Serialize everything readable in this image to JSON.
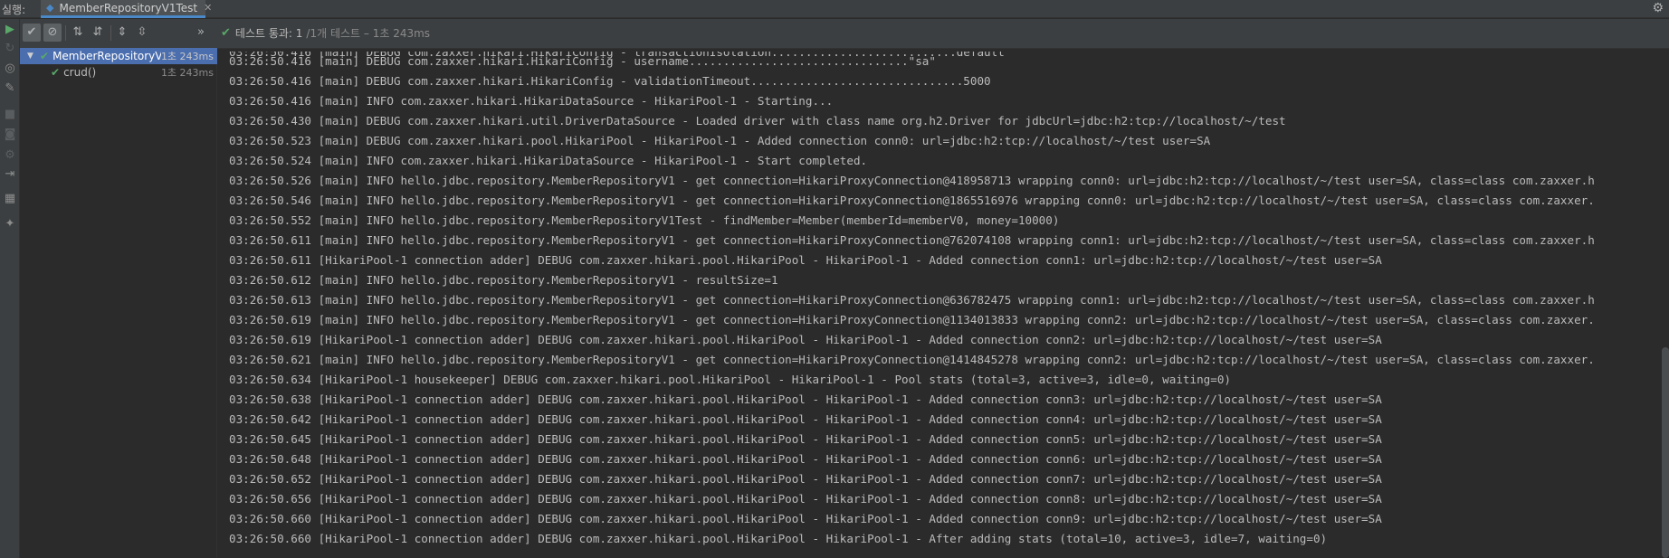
{
  "topbar": {
    "run_label": "실행:",
    "tab_title": "MemberRepositoryV1Test",
    "tab_icon": "run-config-icon",
    "close_icon": "close-icon",
    "settings_icon": "gear-icon"
  },
  "left_toolbar": [
    {
      "name": "rerun-icon",
      "glyph": "▶"
    },
    {
      "name": "rerun-failed-icon",
      "glyph": "↻"
    },
    {
      "name": "debug-icon",
      "glyph": "◎"
    },
    {
      "name": "wrench-icon",
      "glyph": "🔧"
    },
    {
      "name": "stop-icon",
      "glyph": "■"
    },
    {
      "name": "camera-icon",
      "glyph": "◙"
    },
    {
      "name": "settings-icon",
      "glyph": "⚙"
    },
    {
      "name": "exit-icon",
      "glyph": "⇥"
    },
    {
      "name": "layout-icon",
      "glyph": "▦"
    },
    {
      "name": "pin-icon",
      "glyph": "📌"
    }
  ],
  "test_toolbar": {
    "buttons": [
      {
        "name": "show-passed-button",
        "glyph": "✔"
      },
      {
        "name": "show-ignored-button",
        "glyph": "⊘"
      },
      {
        "name": "sort-alpha-button",
        "glyph": "⇅"
      },
      {
        "name": "sort-duration-button",
        "glyph": "⇵"
      },
      {
        "name": "expand-all-button",
        "glyph": "⇕"
      },
      {
        "name": "collapse-all-button",
        "glyph": "⇳"
      },
      {
        "name": "more-button",
        "glyph": "»"
      }
    ],
    "status_text": "테스트 통과: 1",
    "status_detail": "/1개 테스트 – 1초 243ms"
  },
  "tree": {
    "root": {
      "label": "MemberRepositoryV1",
      "time": "1초 243ms"
    },
    "children": [
      {
        "label": "crud()",
        "time": "1초 243ms"
      }
    ]
  },
  "console": {
    "lines": [
      "03:26:50.416 [main] DEBUG com.zaxxer.hikari.HikariConfig - username................................\"sa\"",
      "03:26:50.416 [main] DEBUG com.zaxxer.hikari.HikariConfig - validationTimeout...............................5000",
      "03:26:50.416 [main] INFO com.zaxxer.hikari.HikariDataSource - HikariPool-1 - Starting...",
      "03:26:50.430 [main] DEBUG com.zaxxer.hikari.util.DriverDataSource - Loaded driver with class name org.h2.Driver for jdbcUrl=jdbc:h2:tcp://localhost/~/test",
      "03:26:50.523 [main] DEBUG com.zaxxer.hikari.pool.HikariPool - HikariPool-1 - Added connection conn0: url=jdbc:h2:tcp://localhost/~/test user=SA",
      "03:26:50.524 [main] INFO com.zaxxer.hikari.HikariDataSource - HikariPool-1 - Start completed.",
      "03:26:50.526 [main] INFO hello.jdbc.repository.MemberRepositoryV1 - get connection=HikariProxyConnection@418958713 wrapping conn0: url=jdbc:h2:tcp://localhost/~/test user=SA, class=class com.zaxxer.h",
      "03:26:50.546 [main] INFO hello.jdbc.repository.MemberRepositoryV1 - get connection=HikariProxyConnection@1865516976 wrapping conn0: url=jdbc:h2:tcp://localhost/~/test user=SA, class=class com.zaxxer.",
      "03:26:50.552 [main] INFO hello.jdbc.repository.MemberRepositoryV1Test - findMember=Member(memberId=memberV0, money=10000)",
      "03:26:50.611 [main] INFO hello.jdbc.repository.MemberRepositoryV1 - get connection=HikariProxyConnection@762074108 wrapping conn1: url=jdbc:h2:tcp://localhost/~/test user=SA, class=class com.zaxxer.h",
      "03:26:50.611 [HikariPool-1 connection adder] DEBUG com.zaxxer.hikari.pool.HikariPool - HikariPool-1 - Added connection conn1: url=jdbc:h2:tcp://localhost/~/test user=SA",
      "03:26:50.612 [main] INFO hello.jdbc.repository.MemberRepositoryV1 - resultSize=1",
      "03:26:50.613 [main] INFO hello.jdbc.repository.MemberRepositoryV1 - get connection=HikariProxyConnection@636782475 wrapping conn1: url=jdbc:h2:tcp://localhost/~/test user=SA, class=class com.zaxxer.h",
      "03:26:50.619 [main] INFO hello.jdbc.repository.MemberRepositoryV1 - get connection=HikariProxyConnection@1134013833 wrapping conn2: url=jdbc:h2:tcp://localhost/~/test user=SA, class=class com.zaxxer.",
      "03:26:50.619 [HikariPool-1 connection adder] DEBUG com.zaxxer.hikari.pool.HikariPool - HikariPool-1 - Added connection conn2: url=jdbc:h2:tcp://localhost/~/test user=SA",
      "03:26:50.621 [main] INFO hello.jdbc.repository.MemberRepositoryV1 - get connection=HikariProxyConnection@1414845278 wrapping conn2: url=jdbc:h2:tcp://localhost/~/test user=SA, class=class com.zaxxer.",
      "03:26:50.634 [HikariPool-1 housekeeper] DEBUG com.zaxxer.hikari.pool.HikariPool - HikariPool-1 - Pool stats (total=3, active=3, idle=0, waiting=0)",
      "03:26:50.638 [HikariPool-1 connection adder] DEBUG com.zaxxer.hikari.pool.HikariPool - HikariPool-1 - Added connection conn3: url=jdbc:h2:tcp://localhost/~/test user=SA",
      "03:26:50.642 [HikariPool-1 connection adder] DEBUG com.zaxxer.hikari.pool.HikariPool - HikariPool-1 - Added connection conn4: url=jdbc:h2:tcp://localhost/~/test user=SA",
      "03:26:50.645 [HikariPool-1 connection adder] DEBUG com.zaxxer.hikari.pool.HikariPool - HikariPool-1 - Added connection conn5: url=jdbc:h2:tcp://localhost/~/test user=SA",
      "03:26:50.648 [HikariPool-1 connection adder] DEBUG com.zaxxer.hikari.pool.HikariPool - HikariPool-1 - Added connection conn6: url=jdbc:h2:tcp://localhost/~/test user=SA",
      "03:26:50.652 [HikariPool-1 connection adder] DEBUG com.zaxxer.hikari.pool.HikariPool - HikariPool-1 - Added connection conn7: url=jdbc:h2:tcp://localhost/~/test user=SA",
      "03:26:50.656 [HikariPool-1 connection adder] DEBUG com.zaxxer.hikari.pool.HikariPool - HikariPool-1 - Added connection conn8: url=jdbc:h2:tcp://localhost/~/test user=SA",
      "03:26:50.660 [HikariPool-1 connection adder] DEBUG com.zaxxer.hikari.pool.HikariPool - HikariPool-1 - Added connection conn9: url=jdbc:h2:tcp://localhost/~/test user=SA",
      "03:26:50.660 [HikariPool-1 connection adder] DEBUG com.zaxxer.hikari.pool.HikariPool - HikariPool-1 - After adding stats (total=10, active=3, idle=7, waiting=0)"
    ]
  },
  "colors": {
    "background": "#2b2b2b",
    "toolbar": "#3c3f41",
    "selection": "#4b6eaf",
    "pass_green": "#59a869",
    "text": "#bbbbbb"
  }
}
